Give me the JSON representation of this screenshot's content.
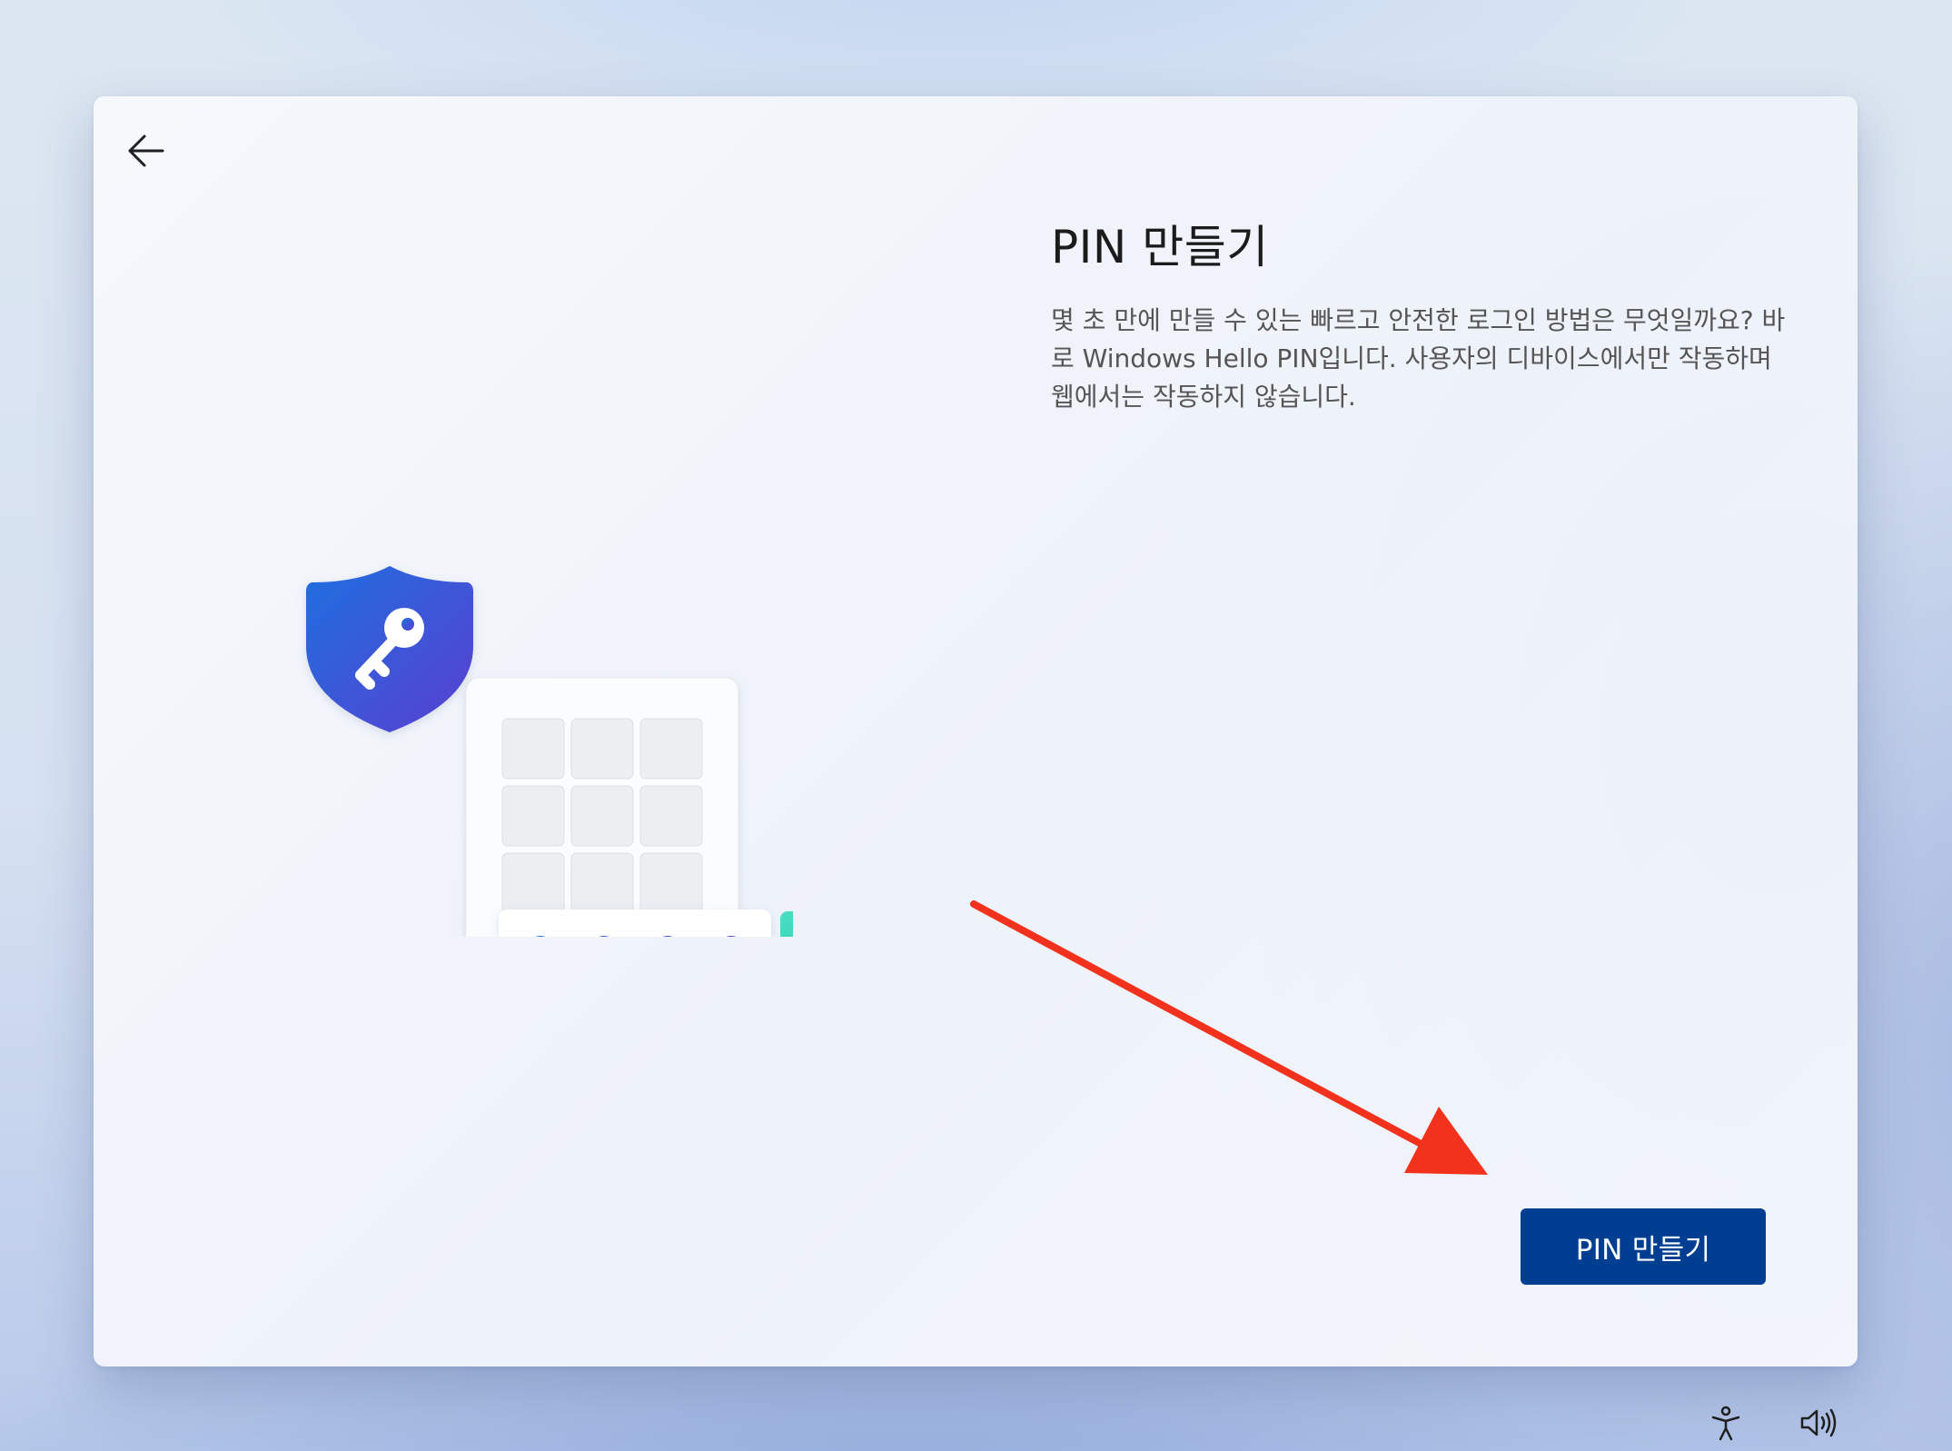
{
  "navigation": {
    "back_icon": "arrow-left-icon"
  },
  "content": {
    "title": "PIN 만들기",
    "description": "몇 초 만에 만들 수 있는 빠르고 안전한 로그인 방법은 무엇일까요? 바로 Windows Hello PIN입니다. 사용자의 디바이스에서만 작동하며 웹에서는 작동하지 않습니다."
  },
  "illustration": {
    "icons": [
      "shield-key-icon",
      "keypad-icon",
      "pin-dots",
      "unlock-icon"
    ],
    "pin_dot_count": 4
  },
  "actions": {
    "primary_label": "PIN 만들기"
  },
  "system_tray": {
    "icons": [
      "accessibility-icon",
      "volume-icon"
    ]
  },
  "colors": {
    "accent": "#003e92",
    "shield": "#2a5fd6",
    "unlock": "#3fd1b8",
    "annotation": "#f2321c"
  }
}
